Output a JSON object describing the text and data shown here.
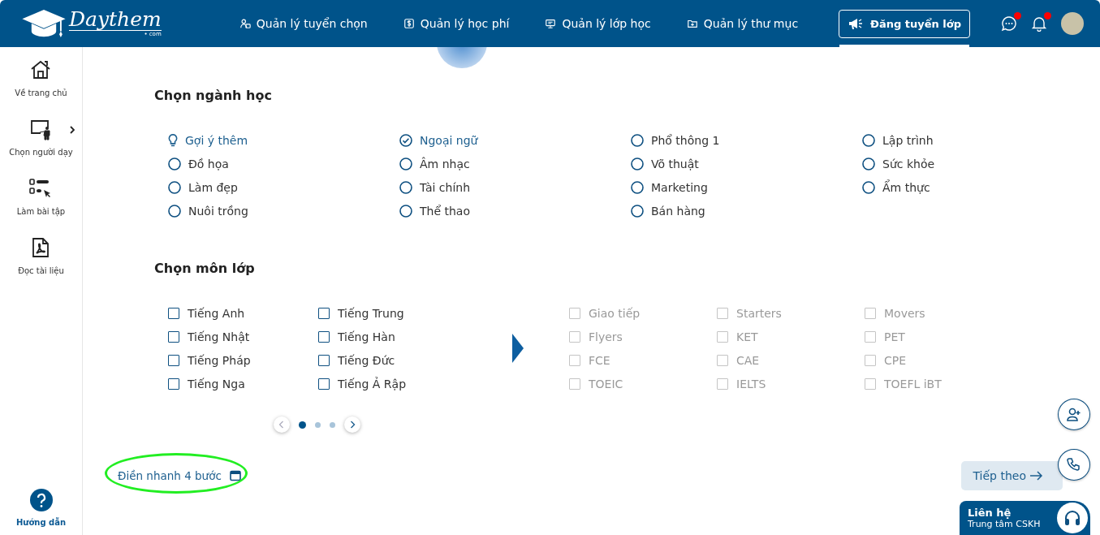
{
  "header": {
    "logo": {
      "name": "Daythem",
      "suffix": "• com"
    },
    "nav": [
      {
        "label": "Quản lý tuyển chọn",
        "kind": "people"
      },
      {
        "label": "Quản lý học phí",
        "kind": "fee"
      },
      {
        "label": "Quản lý lớp học",
        "kind": "class"
      },
      {
        "label": "Quản lý thư mục",
        "kind": "folder"
      }
    ],
    "post_button": {
      "label": "Đăng tuyển lớp",
      "selected": true
    },
    "chat_unread": true,
    "notifications_unread": true
  },
  "sidebar": {
    "items": [
      {
        "label": "Về trang chủ",
        "kind": "home",
        "submenu": false
      },
      {
        "label": "Chọn người dạy",
        "kind": "teacher",
        "submenu": true
      },
      {
        "label": "Làm bài tập",
        "kind": "exercise",
        "submenu": false
      },
      {
        "label": "Đọc tài liệu",
        "kind": "pdf",
        "submenu": false
      }
    ],
    "help": {
      "label": "Hướng dẫn"
    }
  },
  "majors": {
    "title": "Chọn ngành học",
    "items": [
      {
        "label": "Gợi ý thêm",
        "kind": "hint",
        "selected": false
      },
      {
        "label": "Ngoại ngữ",
        "kind": "radio",
        "selected": true
      },
      {
        "label": "Phổ thông 1",
        "kind": "radio",
        "selected": false
      },
      {
        "label": "Lập trình",
        "kind": "radio",
        "selected": false
      },
      {
        "label": "Đồ họa",
        "kind": "radio",
        "selected": false
      },
      {
        "label": "Âm nhạc",
        "kind": "radio",
        "selected": false
      },
      {
        "label": "Võ thuật",
        "kind": "radio",
        "selected": false
      },
      {
        "label": "Sức khỏe",
        "kind": "radio",
        "selected": false
      },
      {
        "label": "Làm đẹp",
        "kind": "radio",
        "selected": false
      },
      {
        "label": "Tài chính",
        "kind": "radio",
        "selected": false
      },
      {
        "label": "Marketing",
        "kind": "radio",
        "selected": false
      },
      {
        "label": "Ẩm thực",
        "kind": "radio",
        "selected": false
      },
      {
        "label": "Nuôi trồng",
        "kind": "radio",
        "selected": false
      },
      {
        "label": "Thể thao",
        "kind": "radio",
        "selected": false
      },
      {
        "label": "Bán hàng",
        "kind": "radio",
        "selected": false
      }
    ]
  },
  "subjects": {
    "title": "Chọn môn lớp",
    "groups": [
      {
        "items": [
          {
            "label": "Tiếng Anh",
            "checked": false,
            "disabled": false
          },
          {
            "label": "Tiếng Trung",
            "checked": false,
            "disabled": false
          },
          {
            "label": "Tiếng Nhật",
            "checked": false,
            "disabled": false
          },
          {
            "label": "Tiếng Hàn",
            "checked": false,
            "disabled": false
          },
          {
            "label": "Tiếng Pháp",
            "checked": false,
            "disabled": false
          },
          {
            "label": "Tiếng Đức",
            "checked": false,
            "disabled": false
          },
          {
            "label": "Tiếng Nga",
            "checked": false,
            "disabled": false
          },
          {
            "label": "Tiếng Ả Rập",
            "checked": false,
            "disabled": false
          }
        ]
      },
      {
        "items": [
          {
            "label": "Giao tiếp",
            "checked": false,
            "disabled": true
          },
          {
            "label": "Starters",
            "checked": false,
            "disabled": true
          },
          {
            "label": "Movers",
            "checked": false,
            "disabled": true
          },
          {
            "label": "Flyers",
            "checked": false,
            "disabled": true
          },
          {
            "label": "KET",
            "checked": false,
            "disabled": true
          },
          {
            "label": "PET",
            "checked": false,
            "disabled": true
          },
          {
            "label": "FCE",
            "checked": false,
            "disabled": true
          },
          {
            "label": "CAE",
            "checked": false,
            "disabled": true
          },
          {
            "label": "CPE",
            "checked": false,
            "disabled": true
          },
          {
            "label": "TOEIC",
            "checked": false,
            "disabled": true
          },
          {
            "label": "IELTS",
            "checked": false,
            "disabled": true
          },
          {
            "label": "TOEFL iBT",
            "checked": false,
            "disabled": true
          }
        ]
      }
    ],
    "pages": [
      {
        "selected": true
      },
      {
        "selected": false
      },
      {
        "selected": false
      }
    ]
  },
  "quick_fill": {
    "label": "Điền nhanh 4 bước",
    "circled": true
  },
  "next_button": {
    "label": "Tiếp theo"
  },
  "floating_buttons": [
    {
      "kind": "add-user"
    },
    {
      "kind": "phone"
    }
  ],
  "contact": {
    "title": "Liên hệ",
    "subtitle": "Trung tâm CSKH"
  }
}
